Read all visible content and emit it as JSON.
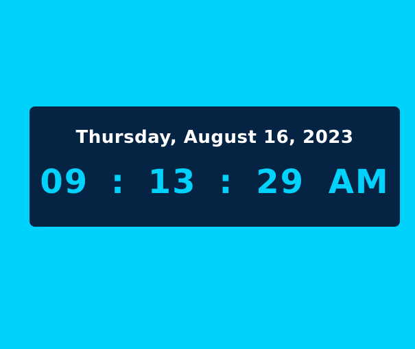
{
  "clock": {
    "date": "Thursday, August 16, 2023",
    "hours": "09",
    "separator_1": ":",
    "minutes": "13",
    "separator_2": ":",
    "seconds": "29",
    "ampm": "AM"
  },
  "colors": {
    "background": "#00D2FC",
    "card": "#052444",
    "date_text": "#FFFFFF",
    "time_text": "#00D2FC"
  }
}
